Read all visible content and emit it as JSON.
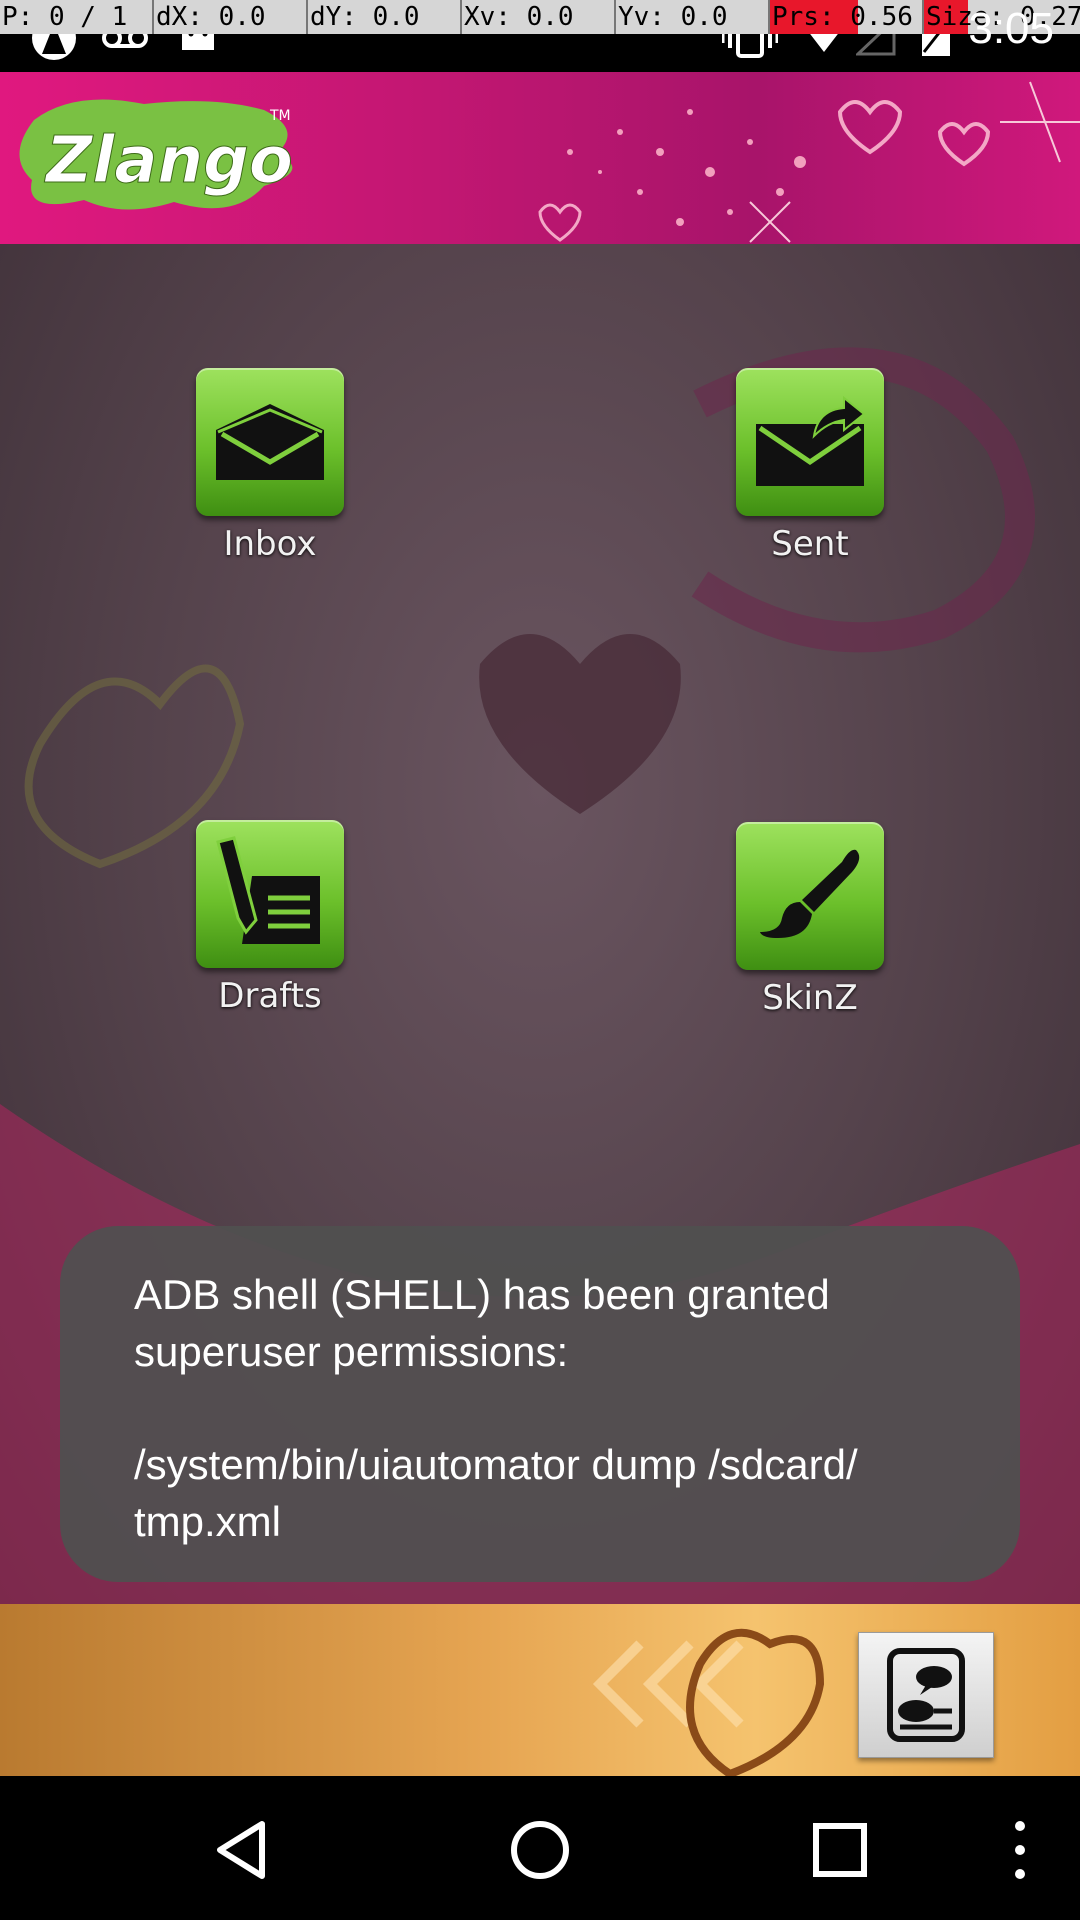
{
  "debug_bar": {
    "pointer": "P: 0 / 1",
    "dx": "dX: 0.0",
    "dy": "dY: 0.0",
    "xv": "Xv: 0.0",
    "yv": "Yv: 0.0",
    "prs": "Prs: 0.56",
    "size": "Size: 0.27"
  },
  "status_bar": {
    "time": "3:05",
    "icons": [
      "app-notification-icon",
      "voicemail-icon",
      "android-icon",
      "vibrate-icon",
      "wifi-icon",
      "signal-icon",
      "battery-icon"
    ]
  },
  "header": {
    "logo_text": "Zlango",
    "trademark": "TM",
    "brand_color": "#e0187f"
  },
  "menu": {
    "inbox_label": "Inbox",
    "sent_label": "Sent",
    "drafts_label": "Drafts",
    "skinz_label": "SkinZ",
    "tile_color": "#6cc02b"
  },
  "toast": {
    "line1": "ADB shell (SHELL) has been granted",
    "line2": "superuser permissions:",
    "line3": "/system/bin/uiautomator dump /sdcard/",
    "line4": "tmp.xml"
  },
  "nav": {
    "icons": [
      "back-icon",
      "home-icon",
      "recents-icon",
      "overflow-menu-icon"
    ]
  }
}
